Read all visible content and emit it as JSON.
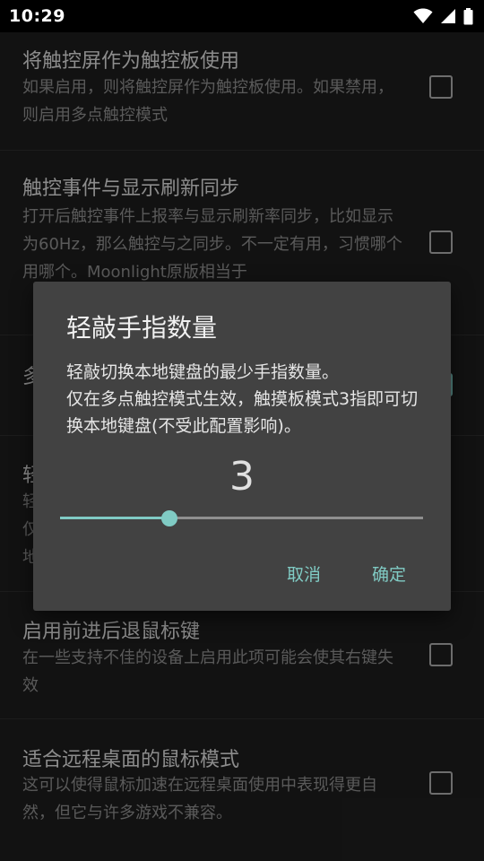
{
  "status_bar": {
    "time": "10:29"
  },
  "settings": [
    {
      "title": "将触控屏作为触控板使用",
      "summary": "如果启用，则将触控屏作为触控板使用。如果禁用，则启用多点触控模式"
    },
    {
      "title": "触控事件与显示刷新同步",
      "summary": "打开后触控事件上报率与显示刷新率同步，比如显示为60Hz，那么触控与之同步。不一定有用，习惯哪个用哪个。Moonlight原版相当于"
    },
    {
      "title": "多"
    },
    {
      "title": "轻",
      "summary_lines": [
        "轻",
        "仅",
        "地"
      ]
    },
    {
      "title": "启用前进后退鼠标键",
      "summary": "在一些支持不佳的设备上启用此项可能会使其右键失效"
    },
    {
      "title": "适合远程桌面的鼠标模式",
      "summary": "这可以使得鼠标加速在远程桌面使用中表现得更自然，但它与许多游戏不兼容。"
    }
  ],
  "dialog": {
    "title": "轻敲手指数量",
    "message_line1": "轻敲切换本地键盘的最少手指数量。",
    "message_line2": "仅在多点触控模式生效，触摸板模式3指即可切换本地键盘(不受此配置影响)。",
    "value": "3",
    "slider": {
      "value": 3,
      "min": 0,
      "max": 10
    },
    "cancel_label": "取消",
    "ok_label": "确定"
  },
  "colors": {
    "accent": "#80cbc4",
    "dialog_bg": "#424242",
    "background": "#1d1d1d"
  },
  "icons": [
    "wifi-icon",
    "signal-icon",
    "battery-icon"
  ]
}
